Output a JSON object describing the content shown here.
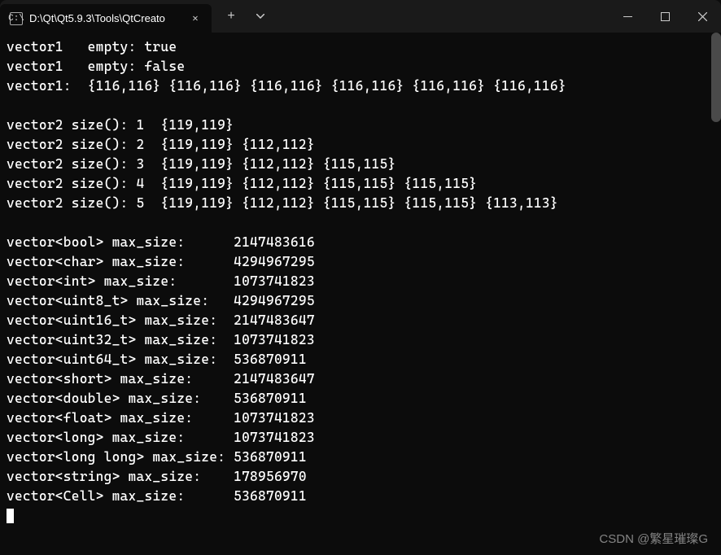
{
  "titlebar": {
    "tab_title": "D:\\Qt\\Qt5.9.3\\Tools\\QtCreato",
    "tab_icon_text": "C:\\",
    "new_tab_label": "+",
    "close_label": "✕"
  },
  "output": {
    "vector1_empty_true": "vector1   empty: true",
    "vector1_empty_false": "vector1   empty: false",
    "vector1_values": "vector1:  {116,116} {116,116} {116,116} {116,116} {116,116} {116,116}",
    "vector2_lines": [
      "vector2 size(): 1  {119,119}",
      "vector2 size(): 2  {119,119} {112,112}",
      "vector2 size(): 3  {119,119} {112,112} {115,115}",
      "vector2 size(): 4  {119,119} {112,112} {115,115} {115,115}",
      "vector2 size(): 5  {119,119} {112,112} {115,115} {115,115} {113,113}"
    ],
    "maxsize_lines": [
      "vector<bool> max_size:      2147483616",
      "vector<char> max_size:      4294967295",
      "vector<int> max_size:       1073741823",
      "vector<uint8_t> max_size:   4294967295",
      "vector<uint16_t> max_size:  2147483647",
      "vector<uint32_t> max_size:  1073741823",
      "vector<uint64_t> max_size:  536870911",
      "vector<short> max_size:     2147483647",
      "vector<double> max_size:    536870911",
      "vector<float> max_size:     1073741823",
      "vector<long> max_size:      1073741823",
      "vector<long long> max_size: 536870911",
      "vector<string> max_size:    178956970",
      "vector<Cell> max_size:      536870911"
    ]
  },
  "watermark": "CSDN @繁星璀璨G"
}
